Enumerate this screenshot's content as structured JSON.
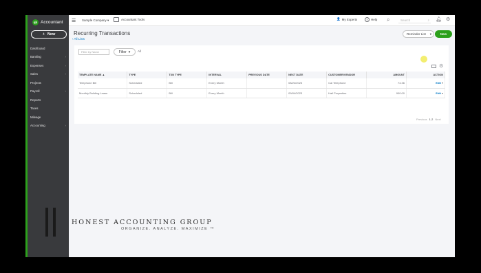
{
  "brand": {
    "logo_text": "qb",
    "name": "Accountant"
  },
  "sidebar": {
    "new_label": "New",
    "items": [
      {
        "label": "Dashboard",
        "has_submenu": false
      },
      {
        "label": "Banking",
        "has_submenu": true
      },
      {
        "label": "Expenses",
        "has_submenu": true
      },
      {
        "label": "Sales",
        "has_submenu": true
      },
      {
        "label": "Projects",
        "has_submenu": false
      },
      {
        "label": "Payroll",
        "has_submenu": true
      },
      {
        "label": "Reports",
        "has_submenu": false
      },
      {
        "label": "Taxes",
        "has_submenu": false
      },
      {
        "label": "Mileage",
        "has_submenu": false
      },
      {
        "label": "Accounting",
        "has_submenu": true
      }
    ]
  },
  "topbar": {
    "company": "Sample Company",
    "tools": "Accountant Tools",
    "experts": "My Experts",
    "help": "Help",
    "search_placeholder": "Search"
  },
  "page": {
    "title": "Recurring Transactions",
    "back_link": "All Lists",
    "reminder_label": "Reminder List",
    "new_label": "New"
  },
  "filters": {
    "name_placeholder": "Filter by Name",
    "filter_label": "Filter",
    "all_label": "All"
  },
  "table": {
    "columns": [
      "TEMPLATE NAME ▲",
      "TYPE",
      "TXN TYPE",
      "INTERVAL",
      "PREVIOUS DATE",
      "NEXT DATE",
      "CUSTOMER/VENDOR",
      "AMOUNT",
      "ACTION"
    ],
    "rows": [
      [
        "Telephone Bill",
        "Scheduled",
        "Bill",
        "Every Month",
        "",
        "08/24/2023",
        "Cal Telephone",
        "74.36",
        "Edit"
      ],
      [
        "Monthly Building Lease",
        "Scheduled",
        "Bill",
        "Every Month",
        "",
        "09/04/2023",
        "Hall Properties",
        "900.00",
        "Edit"
      ]
    ]
  },
  "pager": {
    "prev": "Previous",
    "range": "1-2",
    "next": "Next"
  },
  "watermark": {
    "title": "HONEST ACCOUNTING GROUP",
    "tagline": "ORGANIZE. ANALYZE. MAXIMIZE ™"
  },
  "colors": {
    "accent": "#2ca01c",
    "sidebar_bg": "#393a3d",
    "link": "#0077c5"
  }
}
